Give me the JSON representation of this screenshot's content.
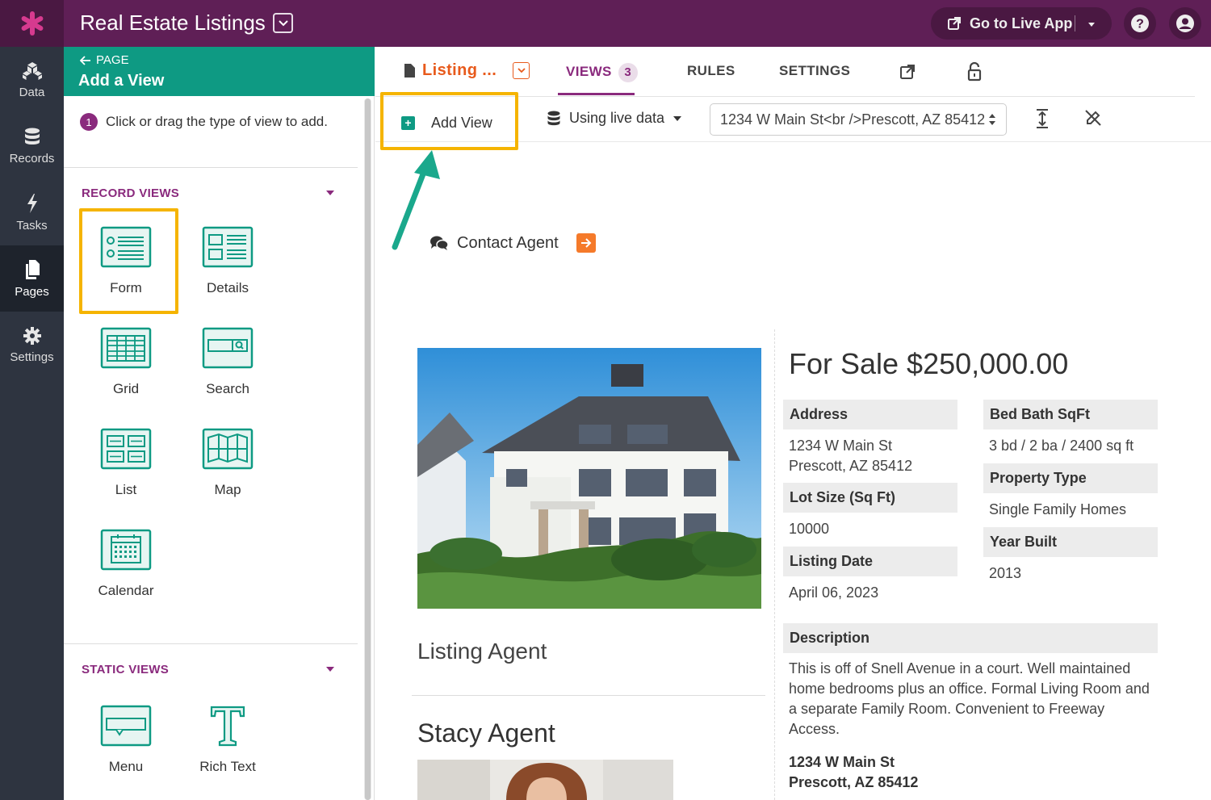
{
  "topbar": {
    "app_title": "Real Estate Listings",
    "live_app_label": "Go to Live App"
  },
  "leftnav": [
    {
      "label": "Data",
      "icon": "data-icon"
    },
    {
      "label": "Records",
      "icon": "database-icon"
    },
    {
      "label": "Tasks",
      "icon": "bolt-icon"
    },
    {
      "label": "Pages",
      "icon": "pages-icon",
      "active": true
    },
    {
      "label": "Settings",
      "icon": "gear-icon"
    }
  ],
  "panel": {
    "back_label": "PAGE",
    "title": "Add a View",
    "step_number": "1",
    "step_text": "Click or drag the type of view to add.",
    "record_views_title": "RECORD VIEWS",
    "record_views": [
      "Form",
      "Details",
      "Grid",
      "Search",
      "List",
      "Map",
      "Calendar"
    ],
    "static_views_title": "STATIC VIEWS",
    "static_views": [
      "Menu",
      "Rich Text"
    ]
  },
  "tabs": {
    "page_name": "Listing ...",
    "views_label": "VIEWS",
    "views_count": "3",
    "rules_label": "RULES",
    "settings_label": "SETTINGS"
  },
  "toolbar": {
    "add_view_label": "Add View",
    "live_data_label": "Using live data",
    "record_value": "1234 W Main St<br />Prescott, AZ 85412"
  },
  "content": {
    "contact_label": "Contact Agent",
    "price": "For Sale $250,000.00",
    "fields_left": [
      {
        "label": "Address",
        "value": [
          "1234 W Main St",
          "Prescott, AZ 85412"
        ]
      },
      {
        "label": "Lot Size (Sq Ft)",
        "value": [
          "10000"
        ]
      },
      {
        "label": "Listing Date",
        "value": [
          "April 06, 2023"
        ]
      }
    ],
    "fields_right": [
      {
        "label": "Bed Bath SqFt",
        "value": [
          "3 bd / 2 ba / 2400 sq ft"
        ]
      },
      {
        "label": "Property Type",
        "value": [
          "Single Family Homes"
        ]
      },
      {
        "label": "Year Built",
        "value": [
          "2013"
        ]
      }
    ],
    "description_label": "Description",
    "description": "This is off of Snell Avenue in a court. Well maintained home bedrooms plus an office. Formal Living Room and a separate Family Room. Convenient to Freeway Access.",
    "address_line1": "1234 W Main St",
    "address_line2": "Prescott, AZ 85412",
    "listing_agent_title": "Listing Agent",
    "agent_name": "Stacy Agent"
  },
  "colors": {
    "topbar": "#5f1f56",
    "accent_purple": "#8a2a7d",
    "teal": "#0e9a83",
    "highlight": "#f5b400",
    "orange": "#e85a1c",
    "leftnav": "#2e3440"
  }
}
